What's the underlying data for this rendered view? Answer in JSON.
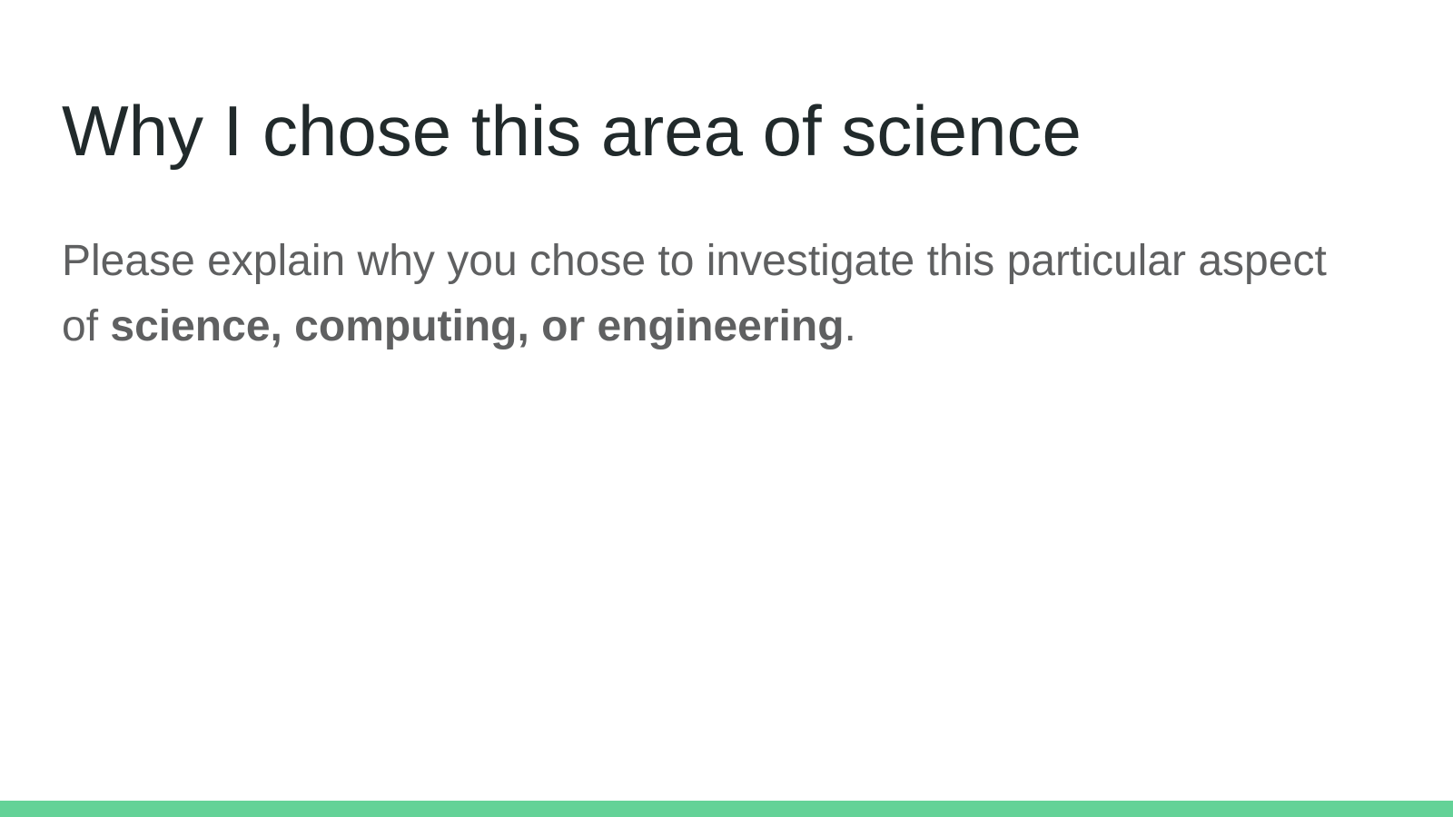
{
  "slide": {
    "title": "Why I chose this area of science",
    "body_prefix": "Please explain why you chose to investigate this particular aspect of ",
    "body_emphasis": "science, computing, or engineering",
    "body_suffix": "."
  },
  "colors": {
    "accent": "#63d297",
    "title": "#212a2b",
    "body": "#5f6061",
    "background": "#ffffff"
  }
}
